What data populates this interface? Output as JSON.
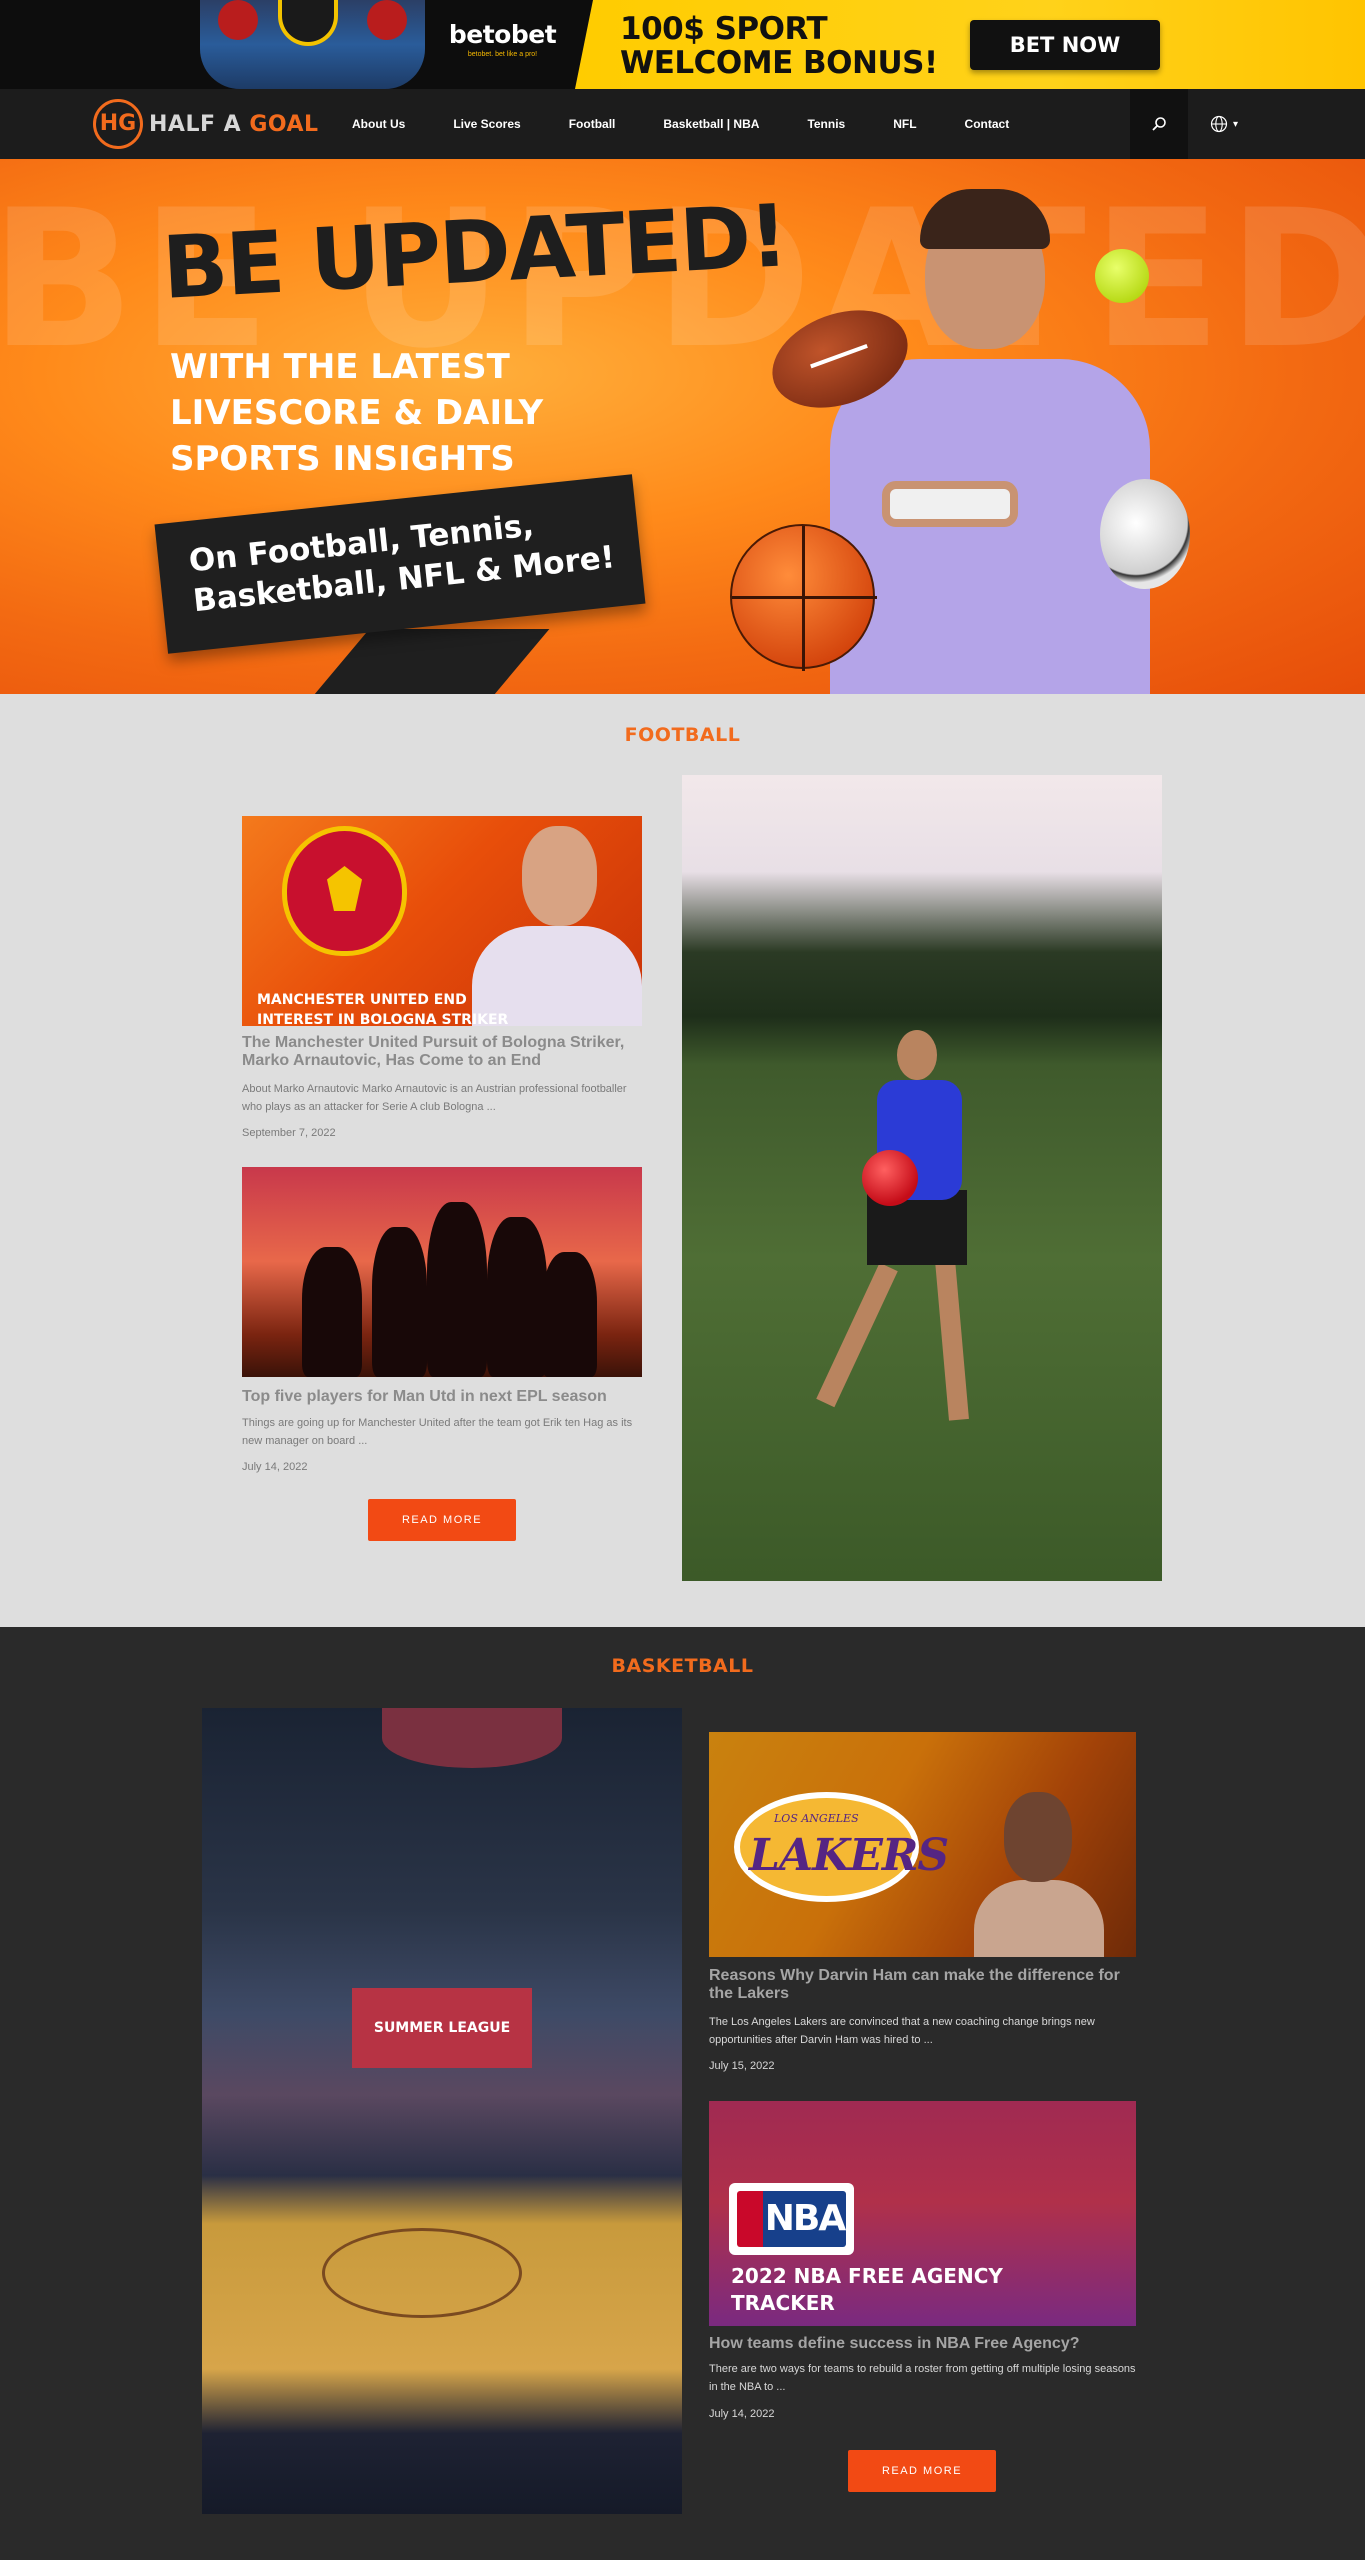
{
  "ad": {
    "brand_name": "betobet",
    "brand_tagline": "betobet. bet like a pro!",
    "headline_line1": "100$ SPORT",
    "headline_line2": "WELCOME BONUS!",
    "cta_label": "BET NOW"
  },
  "nav": {
    "logo_mark": "HG",
    "logo_text_1": "HALF A",
    "logo_text_2": "GOAL",
    "links": [
      "About Us",
      "Live Scores",
      "Football",
      "Basketball | NBA",
      "Tennis",
      "NFL",
      "Contact"
    ],
    "search_icon": "search-icon",
    "language_icon": "globe-icon",
    "language_caret": "▾"
  },
  "hero": {
    "background_text": "BE UPDATED!",
    "title": "BE UPDATED!",
    "subtitle_line1": "WITH THE LATEST",
    "subtitle_line2": "LIVESCORE & DAILY",
    "subtitle_line3": "SPORTS INSIGHTS",
    "box_line1": "On Football, Tennis,",
    "box_line2": "Basketball, NFL & More!"
  },
  "football": {
    "section_title": "FOOTBALL",
    "articles": [
      {
        "image_caption_1": "MANCHESTER UNITED END",
        "image_caption_2": "INTEREST IN BOLOGNA STRIKER",
        "crest_text": "MANCHESTER UNITED",
        "title": "The Manchester United Pursuit of Bologna Striker, Marko Arnautovic, Has Come to an End",
        "excerpt": "About Marko Arnautovic Marko Arnautovic is an Austrian professional footballer who plays as an attacker for Serie A club Bologna ...",
        "date": "September 7, 2022"
      },
      {
        "title": "Top five players for Man Utd in next EPL season",
        "excerpt": "Things are going up for Manchester United after the team got Erik ten Hag as its new manager on board ...",
        "date": "July 14, 2022"
      }
    ],
    "read_more": "READ MORE"
  },
  "basketball": {
    "section_title": "BASKETBALL",
    "arena_banner": "SUMMER LEAGUE",
    "articles": [
      {
        "image_top_text": "LOS ANGELES",
        "image_text": "LAKERS",
        "title": "Reasons Why Darvin Ham can make the difference for the Lakers",
        "excerpt": "The Los Angeles Lakers are convinced that a new coaching change brings new opportunities after Darvin Ham was hired to ...",
        "date": "July 15, 2022"
      },
      {
        "image_logo": "NBA",
        "image_caption_1": "2022 NBA FREE AGENCY",
        "image_caption_2": "TRACKER",
        "title": "How teams define success in NBA Free Agency?",
        "excerpt": "There are two ways for teams to rebuild a roster from getting off multiple losing seasons in the NBA to ...",
        "date": "July 14, 2022"
      }
    ],
    "read_more": "READ MORE"
  },
  "colors": {
    "accent": "#f26b1d",
    "button": "#f24a14",
    "ad_yellow": "#ffcc00",
    "dark": "#1c1c1c"
  }
}
